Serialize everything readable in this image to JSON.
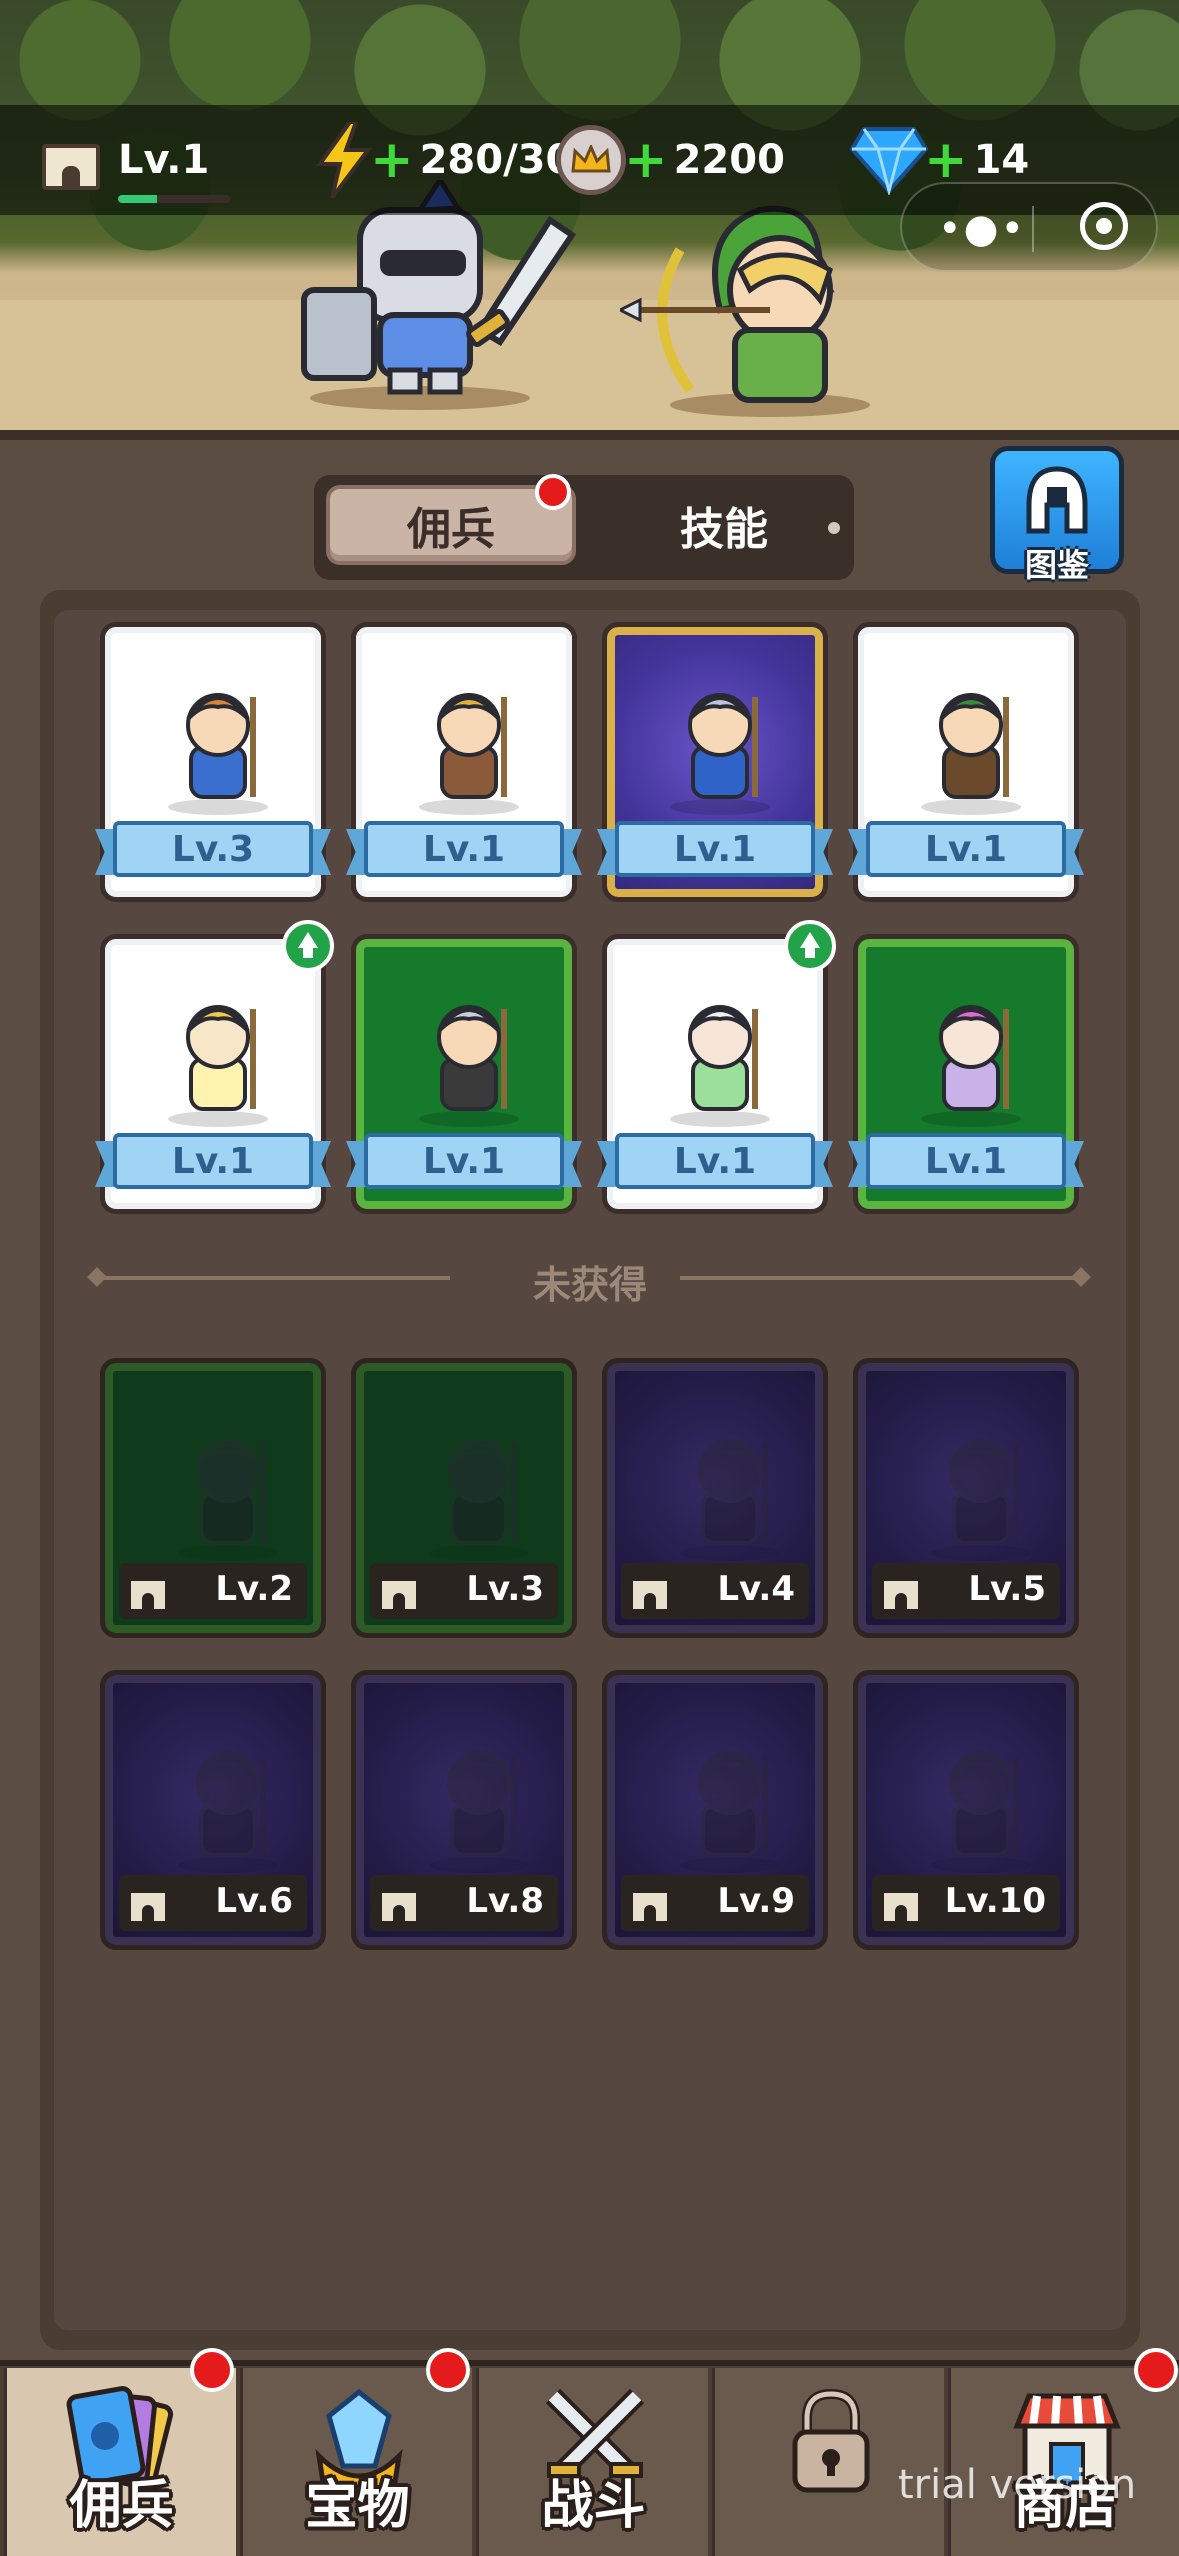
{
  "hud": {
    "level": "Lv.1",
    "level_progress": 0.35,
    "energy": "280/30",
    "coins": "2200",
    "gems": "14"
  },
  "tabs": {
    "mercenary": "佣兵",
    "skills": "技能"
  },
  "codex": {
    "label": "图鉴"
  },
  "owned_cards": [
    {
      "hero": "farmer",
      "level": "Lv.3",
      "frame": "white"
    },
    {
      "hero": "swordsman",
      "level": "Lv.1",
      "frame": "white"
    },
    {
      "hero": "paladin",
      "level": "Lv.1",
      "frame": "purple"
    },
    {
      "hero": "archer",
      "level": "Lv.1",
      "frame": "white"
    },
    {
      "hero": "priestess",
      "level": "Lv.1",
      "frame": "white",
      "upgrade": true
    },
    {
      "hero": "knight",
      "level": "Lv.1",
      "frame": "green"
    },
    {
      "hero": "healer",
      "level": "Lv.1",
      "frame": "white",
      "upgrade": true
    },
    {
      "hero": "cleric",
      "level": "Lv.1",
      "frame": "green"
    }
  ],
  "not_obtained_label": "未获得",
  "locked_cards": [
    {
      "hero": "elf-archer",
      "level": "Lv.2",
      "frame": "green"
    },
    {
      "hero": "lightning-mage",
      "level": "Lv.3",
      "frame": "green"
    },
    {
      "hero": "fire-mage",
      "level": "Lv.4",
      "frame": "purple"
    },
    {
      "hero": "assassin",
      "level": "Lv.5",
      "frame": "purple"
    },
    {
      "hero": "warlock",
      "level": "Lv.6",
      "frame": "purple"
    },
    {
      "hero": "sorceress",
      "level": "Lv.8",
      "frame": "purple"
    },
    {
      "hero": "gunner",
      "level": "Lv.9",
      "frame": "purple"
    },
    {
      "hero": "dwarf-guardian",
      "level": "Lv.10",
      "frame": "purple"
    }
  ],
  "nav": [
    {
      "label": "佣兵",
      "icon": "cards-icon",
      "badge": true,
      "active": true
    },
    {
      "label": "宝物",
      "icon": "crystal-icon",
      "badge": true
    },
    {
      "label": "战斗",
      "icon": "crossed-swords-icon",
      "badge": false
    },
    {
      "label": "",
      "icon": "padlock-icon",
      "badge": false
    },
    {
      "label": "商店",
      "icon": "shop-icon",
      "badge": true
    }
  ],
  "watermark": "trial version",
  "colors": {
    "accent_green": "#3fd93a",
    "badge_red": "#e51b1b",
    "level_blue": "#9fd4f5"
  }
}
